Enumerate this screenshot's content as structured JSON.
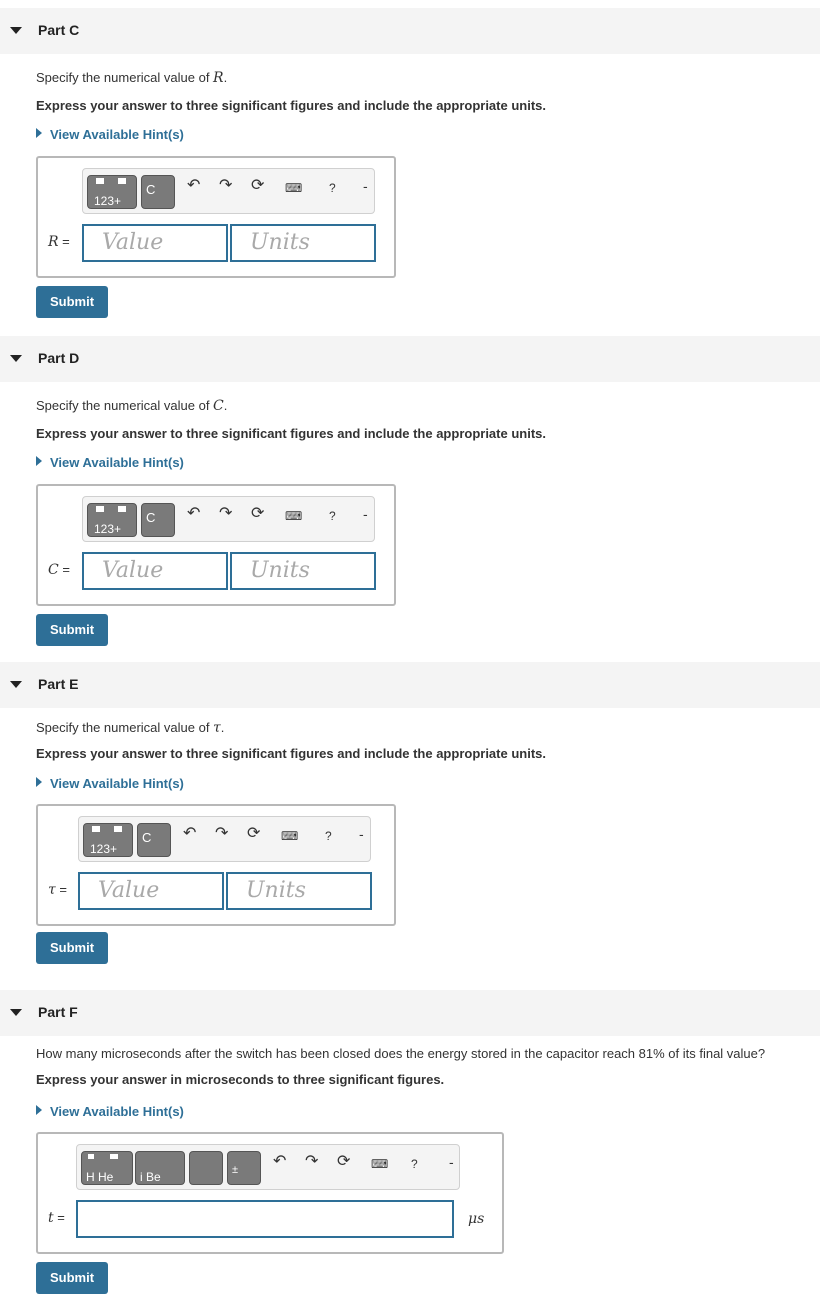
{
  "parts": [
    {
      "title": "Part C",
      "prompt_pre": "Specify the numerical value of ",
      "prompt_var": "R",
      "prompt_post": ".",
      "instruction": "Express your answer to three significant figures and include the appropriate units.",
      "hint": "View Available Hint(s)",
      "var_label": "R",
      "eq": " =",
      "value_placeholder": "Value",
      "units_placeholder": "Units",
      "toolbar_btn": "123+",
      "submit": "Submit"
    },
    {
      "title": "Part D",
      "prompt_pre": "Specify the numerical value of ",
      "prompt_var": "C",
      "prompt_post": ".",
      "instruction": "Express your answer to three significant figures and include the appropriate units.",
      "hint": "View Available Hint(s)",
      "var_label": "C",
      "eq": " =",
      "value_placeholder": "Value",
      "units_placeholder": "Units",
      "toolbar_btn": "123+",
      "submit": "Submit"
    },
    {
      "title": "Part E",
      "prompt_pre": "Specify the numerical value of ",
      "prompt_var": "τ",
      "prompt_post": ".",
      "instruction": "Express your answer to three significant figures and include the appropriate units.",
      "hint": "View Available Hint(s)",
      "var_label": "τ",
      "eq": " =",
      "value_placeholder": "Value",
      "units_placeholder": "Units",
      "toolbar_btn": "123+",
      "submit": "Submit"
    },
    {
      "title": "Part F",
      "prompt": "How many microseconds after the switch has been closed does the energy stored in the capacitor reach 81% of its final value?",
      "instruction": "Express your answer in microseconds to three significant figures.",
      "hint": "View Available Hint(s)",
      "var_label": "t",
      "eq": " =",
      "unit": "μs",
      "toolbar_btn_1": "H He",
      "toolbar_btn_2": "i Be",
      "submit": "Submit"
    }
  ],
  "toolbar_icons": [
    "undo-icon",
    "redo-icon",
    "reset-icon",
    "keyboard-icon",
    "help-icon"
  ],
  "glyphs": {
    "undo": "↶",
    "redo": "↷",
    "reset": "⟳",
    "keyboard": "⌨",
    "help": "?",
    "dash": "-",
    "c": "C",
    "pm": "±"
  },
  "colors": {
    "accent": "#2e6f97",
    "header_bg": "#f4f4f4"
  }
}
